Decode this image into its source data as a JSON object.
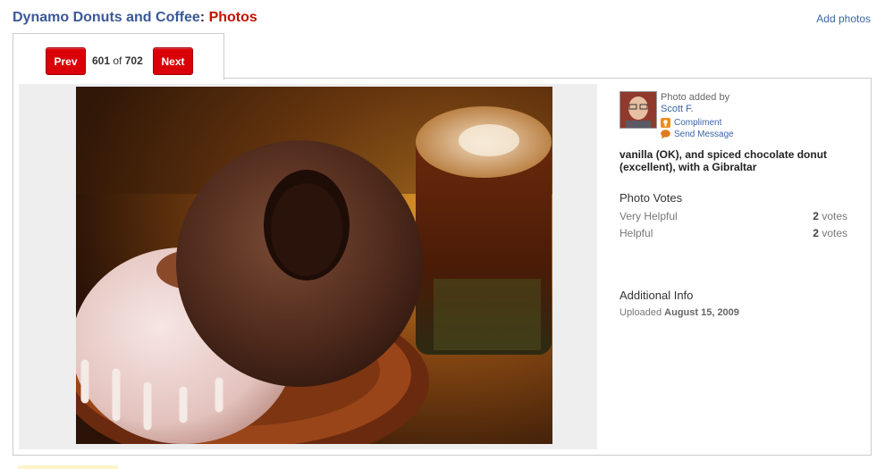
{
  "header": {
    "business_name": "Dynamo Donuts and Coffee",
    "separator": ":",
    "section": "Photos",
    "add_photos": "Add photos"
  },
  "pager": {
    "prev_label": "Prev",
    "next_label": "Next",
    "current": "601",
    "of_label": "of",
    "total": "702"
  },
  "photo": {
    "alt": "vanilla (OK), and spiced chocolate donut (excellent), with a Gibraltar"
  },
  "sidebar": {
    "added_by_label": "Photo added by",
    "user_name": "Scott F.",
    "compliment_label": "Compliment",
    "send_message_label": "Send Message",
    "caption": "vanilla (OK), and spiced chocolate donut (excellent), with a Gibraltar",
    "votes_heading": "Photo Votes",
    "votes": [
      {
        "label": "Very Helpful",
        "count": "2",
        "unit": "votes"
      },
      {
        "label": "Helpful",
        "count": "2",
        "unit": "votes"
      }
    ],
    "info_heading": "Additional Info",
    "uploaded_label": "Uploaded",
    "uploaded_date": "August 15, 2009"
  },
  "icons": {
    "compliment": "compliment-icon",
    "send_message": "speech-bubble-icon"
  },
  "colors": {
    "brand_blue": "#3b5998",
    "accent_red": "#c41200",
    "button_red": "#d90007",
    "link_blue": "#3b65a7"
  }
}
